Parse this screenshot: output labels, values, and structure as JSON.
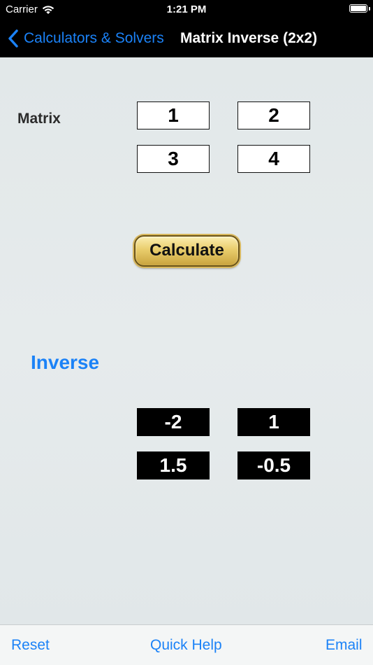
{
  "status_bar": {
    "carrier": "Carrier",
    "time": "1:21 PM",
    "wifi_icon": "wifi-icon",
    "battery_icon": "battery-icon"
  },
  "nav_bar": {
    "back_label": "Calculators & Solvers",
    "back_icon": "chevron-left-icon",
    "title": "Matrix Inverse (2x2)"
  },
  "matrix": {
    "label": "Matrix",
    "cells": [
      [
        "1",
        "2"
      ],
      [
        "3",
        "4"
      ]
    ]
  },
  "calculate_label": "Calculate",
  "inverse": {
    "label": "Inverse",
    "cells": [
      [
        "-2",
        "1"
      ],
      [
        "1.5",
        "-0.5"
      ]
    ]
  },
  "toolbar": {
    "reset_label": "Reset",
    "quick_help_label": "Quick Help",
    "email_label": "Email"
  },
  "colors": {
    "accent": "#1b82f7",
    "nav_background": "#000000",
    "content_background": "#e4e9ea",
    "button_gold": "#e9cd6c"
  }
}
